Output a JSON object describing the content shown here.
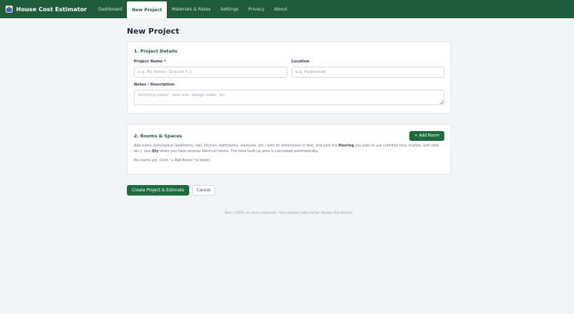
{
  "navbar": {
    "brand": "House Cost Estimator",
    "links": [
      {
        "label": "Dashboard"
      },
      {
        "label": "New Project"
      },
      {
        "label": "Materials & Rates"
      },
      {
        "label": "Settings"
      },
      {
        "label": "Privacy"
      },
      {
        "label": "About"
      }
    ],
    "active_index": 1
  },
  "page": {
    "title": "New Project"
  },
  "project_details": {
    "title": "1. Project Details",
    "name_label": "Project Name *",
    "name_placeholder": "e.g. My Home - Ground + 1",
    "location_label": "Location",
    "location_placeholder": "e.g. Hyderabad",
    "notes_label": "Notes / Description",
    "notes_placeholder": "Anything useful - plot size, design notes, etc."
  },
  "rooms": {
    "title": "2. Rooms & Spaces",
    "add_button": "+ Add Room",
    "desc_part1": "Add every room/space (bedrooms, hall, kitchen, bathrooms, staircase, etc.) with its dimensions in feet, and pick the ",
    "desc_bold1": "flooring",
    "desc_part2": " you plan to use (vitrified tiles, marble, anti-skid, etc.). Use ",
    "desc_bold2": "Qty",
    "desc_part3": " when you have several identical rooms. The total built-up area is calculated automatically.",
    "empty_text": "No rooms yet. Click \"+ Add Room\" to begin."
  },
  "actions": {
    "create": "Create Project & Estimate",
    "cancel": "Cancel"
  },
  "footer": {
    "text": "Runs 100% on your computer. Your project data never leaves this device."
  }
}
